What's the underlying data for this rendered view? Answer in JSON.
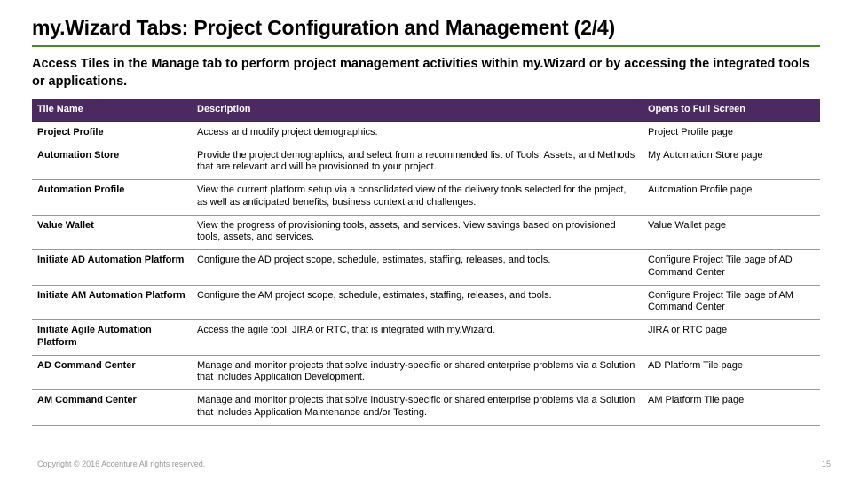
{
  "title": "my.Wizard Tabs: Project Configuration and Management (2/4)",
  "subtitle": "Access Tiles in the Manage tab to perform project management activities within my.Wizard or by accessing the integrated tools or applications.",
  "table": {
    "headers": [
      "Tile Name",
      "Description",
      "Opens to Full Screen"
    ],
    "rows": [
      {
        "name": "Project Profile",
        "desc": "Access and modify project demographics.",
        "opens": "Project Profile page"
      },
      {
        "name": "Automation Store",
        "desc": "Provide the project demographics, and select from a recommended list of Tools, Assets, and Methods that are relevant and will be provisioned to your project.",
        "opens": "My Automation Store page"
      },
      {
        "name": "Automation Profile",
        "desc": "View the current platform setup via a consolidated view of the delivery tools selected for the project, as well as anticipated benefits, business context and challenges.",
        "opens": "Automation Profile page"
      },
      {
        "name": "Value Wallet",
        "desc": "View the progress of provisioning tools, assets, and services. View savings based on provisioned tools, assets, and services.",
        "opens": "Value Wallet page"
      },
      {
        "name": "Initiate AD Automation Platform",
        "desc": "Configure the AD project scope, schedule, estimates, staffing, releases, and tools.",
        "opens": "Configure Project Tile page of AD Command Center"
      },
      {
        "name": "Initiate AM Automation Platform",
        "desc": "Configure the AM project scope, schedule, estimates, staffing, releases, and tools.",
        "opens": "Configure Project Tile page of AM Command Center"
      },
      {
        "name": "Initiate Agile Automation Platform",
        "desc": "Access the agile tool, JIRA or RTC, that is integrated with my.Wizard.",
        "opens": "JIRA or RTC page"
      },
      {
        "name": "AD Command Center",
        "desc": "Manage and monitor projects that solve industry-specific or shared enterprise problems via a Solution that includes Application Development.",
        "opens": "AD Platform Tile page"
      },
      {
        "name": "AM Command Center",
        "desc": "Manage and monitor projects that solve industry-specific or shared enterprise problems via a Solution that includes Application Maintenance and/or Testing.",
        "opens": "AM Platform Tile page"
      }
    ]
  },
  "footer": "Copyright © 2016 Accenture  All rights reserved.",
  "page_number": "15"
}
